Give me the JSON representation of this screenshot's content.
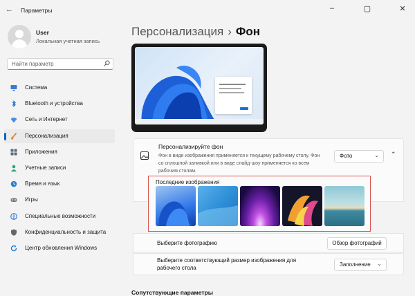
{
  "app": {
    "title": "Параметры"
  },
  "user": {
    "name": "User",
    "subtitle": "Локальная учетная запись"
  },
  "search": {
    "placeholder": "Найти параметр"
  },
  "nav": [
    {
      "label": "Система",
      "icon": "monitor-icon",
      "color": "#3b7bd4",
      "active": false
    },
    {
      "label": "Bluetooth и устройства",
      "icon": "bluetooth-icon",
      "color": "#1f6fd1",
      "active": false
    },
    {
      "label": "Сеть и Интернет",
      "icon": "wifi-icon",
      "color": "#4a8fe0",
      "active": false
    },
    {
      "label": "Персонализация",
      "icon": "brush-icon",
      "color": "#d98a2b",
      "active": true
    },
    {
      "label": "Приложения",
      "icon": "apps-icon",
      "color": "#5a6a7a",
      "active": false
    },
    {
      "label": "Учетные записи",
      "icon": "person-icon",
      "color": "#2aa57a",
      "active": false
    },
    {
      "label": "Время и язык",
      "icon": "globe-clock-icon",
      "color": "#2b7fd0",
      "active": false
    },
    {
      "label": "Игры",
      "icon": "gamepad-icon",
      "color": "#7a7a7a",
      "active": false
    },
    {
      "label": "Специальные возможности",
      "icon": "accessibility-icon",
      "color": "#3c7fd6",
      "active": false
    },
    {
      "label": "Конфиденциальность и защита",
      "icon": "shield-icon",
      "color": "#666666",
      "active": false
    },
    {
      "label": "Центр обновления Windows",
      "icon": "update-icon",
      "color": "#1e78d6",
      "active": false
    }
  ],
  "breadcrumb": {
    "parent": "Персонализация",
    "separator": "›",
    "current": "Фон"
  },
  "background": {
    "title": "Персонализируйте фон",
    "description": "Фон в виде изображения применяется к текущему рабочему столу. Фон со сплошной заливкой или в виде слайд-шоу применяется ко всем рабочим столам.",
    "type_value": "Фото",
    "icon": "image-icon"
  },
  "recent": {
    "title": "Последние изображения",
    "thumbnails": [
      {
        "name": "bloom-blue"
      },
      {
        "name": "blue-curve"
      },
      {
        "name": "purple-glow"
      },
      {
        "name": "colorful-flow"
      },
      {
        "name": "lake-sunset"
      }
    ]
  },
  "choose_photo": {
    "label": "Выберите фотографию",
    "button": "Обзор фотографий"
  },
  "fit": {
    "label": "Выберите соответствующий размер изображения для рабочего стола",
    "value": "Заполнение"
  },
  "related": {
    "title": "Сопутствующие параметры"
  },
  "colors": {
    "accent": "#0067c0",
    "highlight_border": "#d9534f"
  }
}
